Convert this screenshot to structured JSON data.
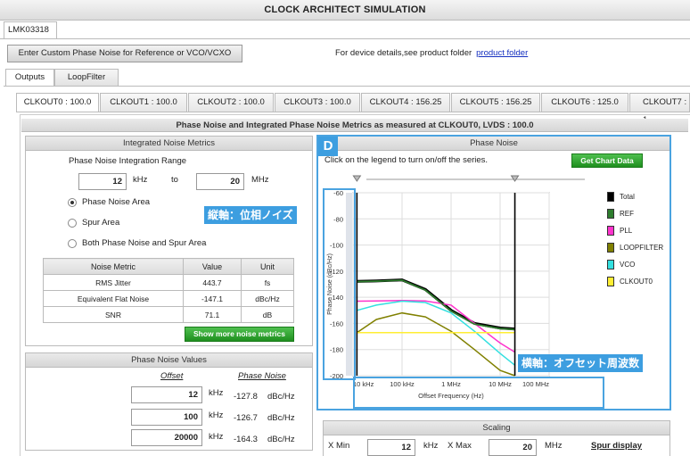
{
  "app": {
    "title": "CLOCK ARCHITECT SIMULATION",
    "device_tab": "LMK03318"
  },
  "toolbar": {
    "custom_noise_button": "Enter Custom Phase Noise for Reference or VCO/VCXO",
    "device_details_text": "For device details,see product folder",
    "product_folder_link": "product folder"
  },
  "main_tabs": [
    {
      "label": "Outputs"
    },
    {
      "label": "LoopFilter"
    }
  ],
  "clk_tabs": [
    {
      "label": "CLKOUT0 : 100.0"
    },
    {
      "label": "CLKOUT1 : 100.0"
    },
    {
      "label": "CLKOUT2 : 100.0"
    },
    {
      "label": "CLKOUT3 : 100.0"
    },
    {
      "label": "CLKOUT4 : 156.25"
    },
    {
      "label": "CLKOUT5 : 156.25"
    },
    {
      "label": "CLKOUT6 : 125.0"
    },
    {
      "label": "CLKOUT7 : 1"
    }
  ],
  "section_header": "Phase Noise and Integrated Phase Noise Metrics as measured at CLKOUT0, LVDS : 100.0",
  "integrated": {
    "header": "Integrated Noise Metrics",
    "range_label": "Phase Noise Integration Range",
    "from_value": "12",
    "from_unit": "kHz",
    "to_label": "to",
    "to_value": "20",
    "to_unit": "MHz",
    "radio_options": [
      "Phase Noise Area",
      "Spur Area",
      "Both Phase Noise and Spur Area"
    ],
    "table": {
      "headers": [
        "Noise Metric",
        "Value",
        "Unit"
      ],
      "rows": [
        [
          "RMS Jitter",
          "443.7",
          "fs"
        ],
        [
          "Equivalent Flat Noise",
          "-147.1",
          "dBc/Hz"
        ],
        [
          "SNR",
          "71.1",
          "dB"
        ]
      ]
    },
    "more_button": "Show more noise metrics"
  },
  "pn_values": {
    "header": "Phase Noise Values",
    "col_offset": "Offset",
    "col_pn": "Phase Noise",
    "rows": [
      {
        "offset": "12",
        "unit": "kHz",
        "value": "-127.8",
        "pn_unit": "dBc/Hz"
      },
      {
        "offset": "100",
        "unit": "kHz",
        "value": "-126.7",
        "pn_unit": "dBc/Hz"
      },
      {
        "offset": "20000",
        "unit": "kHz",
        "value": "-164.3",
        "pn_unit": "dBc/Hz"
      }
    ]
  },
  "phase_noise": {
    "header": "Phase Noise",
    "instruction": "Click on the legend to turn on/off the series.",
    "get_data_button": "Get Chart Data",
    "badge": "D",
    "callout_y": "縦軸：位相ノイズ",
    "callout_x": "横軸：オフセット周波数",
    "accent": "#3d9ee0"
  },
  "scaling": {
    "header": "Scaling",
    "xmin_label": "X Min",
    "xmin_value": "12",
    "xmin_unit": "kHz",
    "xmax_label": "X Max",
    "xmax_value": "20",
    "xmax_unit": "MHz",
    "spur_link": "Spur display"
  },
  "chart_data": {
    "type": "line",
    "xlabel": "Offset Frequency (Hz)",
    "ylabel": "Phase Noise (dBc/Hz)",
    "x_scale": "log",
    "xlim": [
      10000,
      100000000
    ],
    "ylim": [
      -200,
      -60
    ],
    "x_ticks": [
      "10 kHz",
      "100 kHz",
      "1 MHz",
      "10 MHz",
      "100 MHz"
    ],
    "y_ticks": [
      "-60",
      "-80",
      "-100",
      "-120",
      "-140",
      "-160",
      "-180",
      "-200"
    ],
    "x_tick_values": [
      10000,
      100000,
      1000000,
      10000000,
      100000000
    ],
    "y_tick_values": [
      -60,
      -80,
      -100,
      -120,
      -140,
      -160,
      -180,
      -200
    ],
    "integration_markers": [
      12000,
      20000000
    ],
    "legend_position": "right",
    "x": [
      12000,
      30000,
      100000,
      300000,
      1000000,
      3000000,
      10000000,
      20000000
    ],
    "series": [
      {
        "name": "Total",
        "color": "#000000",
        "values": [
          -127.8,
          -127.5,
          -126.7,
          -134,
          -150,
          -160,
          -163.5,
          -164.3
        ]
      },
      {
        "name": "REF",
        "color": "#2e7d2e",
        "values": [
          -128,
          -127.7,
          -126.9,
          -134.5,
          -150.5,
          -160.5,
          -164,
          -164.6
        ]
      },
      {
        "name": "PLL",
        "color": "#ff33cc",
        "values": [
          -143,
          -142.8,
          -142.5,
          -142.8,
          -146,
          -160,
          -175,
          -182
        ]
      },
      {
        "name": "LOOPFILTER",
        "color": "#808000",
        "values": [
          -167,
          -157,
          -152,
          -155,
          -166,
          -180,
          -196,
          -200
        ]
      },
      {
        "name": "VCO",
        "color": "#33e0e0",
        "values": [
          -150,
          -146,
          -143,
          -144,
          -152,
          -166,
          -183,
          -192
        ]
      },
      {
        "name": "CLKOUT0",
        "color": "#ffee33",
        "values": [
          -167,
          -167,
          -167,
          -167,
          -167,
          -167,
          -167,
          -167
        ]
      }
    ]
  }
}
